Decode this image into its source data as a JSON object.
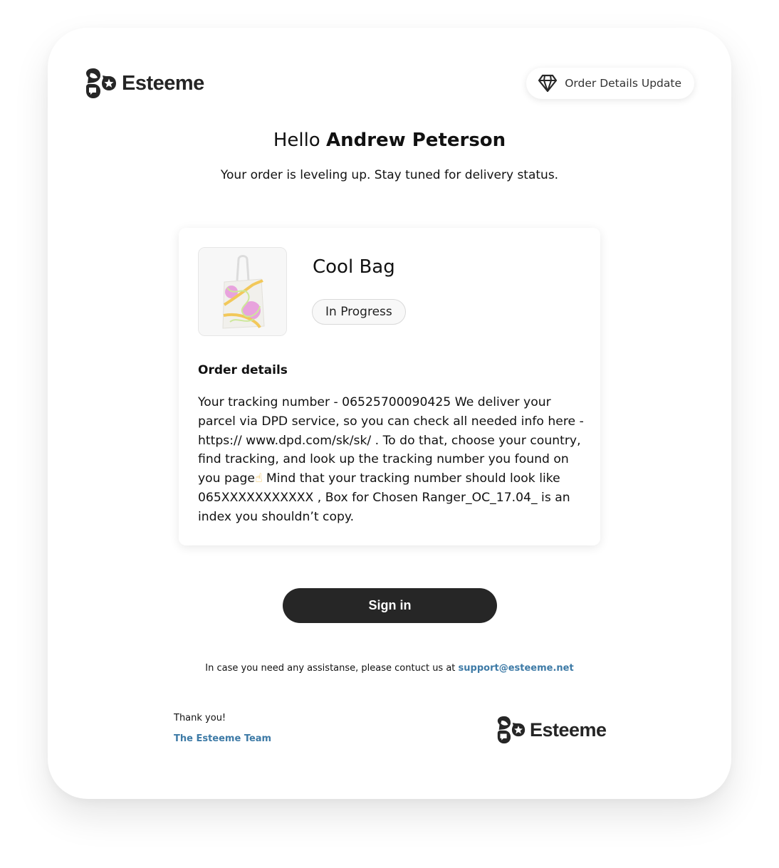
{
  "brand": {
    "name": "Esteeme",
    "logo_icon": "esteeme-logo-icon"
  },
  "header": {
    "badge_icon": "diamond-icon",
    "badge_label": "Order Details Update"
  },
  "greeting": {
    "prefix": "Hello",
    "name": "Andrew Peterson",
    "subtitle": "Your order is leveling up. Stay tuned for delivery status."
  },
  "order": {
    "product_image": "tote-bag-image",
    "product_name": "Cool Bag",
    "status": "In Progress",
    "details_heading": "Order details",
    "details_text_before_emoji": "Your tracking number - 06525700090425 We deliver your parcel via DPD service, so you can check all needed info here - https:// www.dpd.com/sk/sk/ . To do that, choose your country, find tracking, and look up the tracking number you found on you page",
    "details_emoji": "☝",
    "details_text_after_emoji": " Mind that your tracking number should look like 065XXXXXXXXXXX , Box for Chosen Ranger_OC_17.04_ is an index you shouldn’t copy.",
    "colors": {
      "status_pill_bg": "#f8f8f8",
      "emoji_color": "#f2b632"
    }
  },
  "actions": {
    "sign_in_label": "Sign in",
    "sign_in_bg": "#262626"
  },
  "footer": {
    "assist_text": "In case you need any assistanse, please contuct us at ",
    "support_email": "support@esteeme.net",
    "thanks": "Thank you!",
    "team": "The Esteeme Team",
    "link_color": "#3d7aa6"
  }
}
